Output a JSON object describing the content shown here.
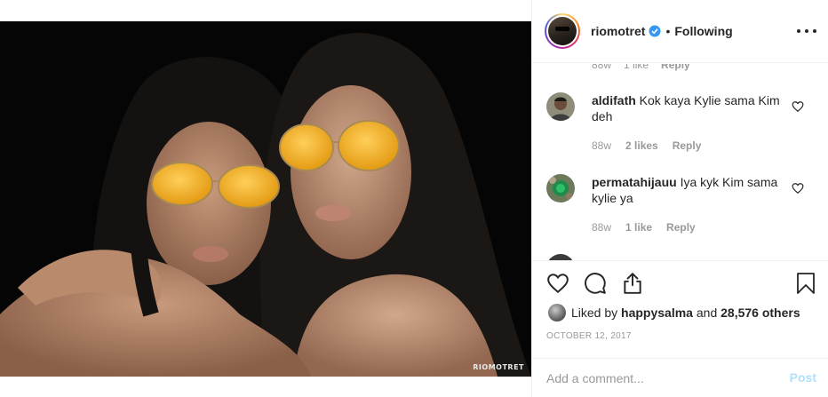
{
  "photo": {
    "watermark": "RIOMOTRET"
  },
  "header": {
    "username": "riomotret",
    "separator": "•",
    "follow_state": "Following",
    "verified_icon": "verified-badge-icon",
    "more_icon": "more-options-icon"
  },
  "partial_comment": {
    "age": "88w",
    "likes": "1 like",
    "reply": "Reply"
  },
  "comments": [
    {
      "username": "aldifath",
      "text": "Kok kaya Kylie sama Kim deh",
      "age": "88w",
      "likes": "2 likes",
      "reply": "Reply"
    },
    {
      "username": "permatahijauu",
      "text": "Iya kyk Kim sama kylie ya",
      "age": "88w",
      "likes": "1 like",
      "reply": "Reply"
    }
  ],
  "actions": {
    "like_icon": "heart-icon",
    "comment_icon": "comment-icon",
    "share_icon": "share-icon",
    "save_icon": "bookmark-icon"
  },
  "likes": {
    "prefix": "Liked by",
    "user": "happysalma",
    "and": "and",
    "others": "28,576 others"
  },
  "date": "OCTOBER 12, 2017",
  "add_comment": {
    "placeholder": "Add a comment...",
    "post_label": "Post"
  },
  "colors": {
    "verified": "#3897f0",
    "post_button_disabled": "#b2dffc",
    "meta_text": "#999999"
  }
}
